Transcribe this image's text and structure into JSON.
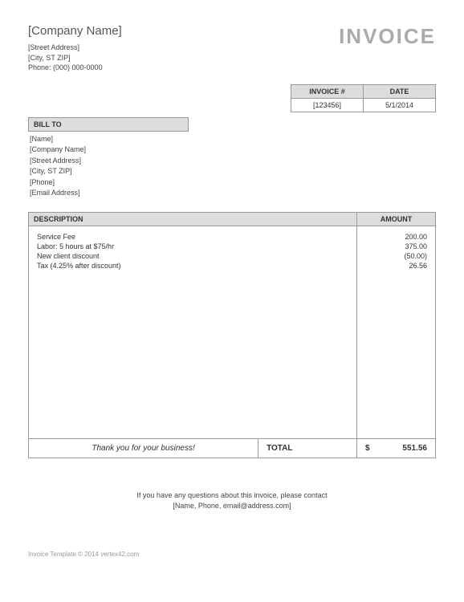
{
  "company": {
    "name": "[Company Name]",
    "street": "[Street Address]",
    "cityzip": "[City, ST  ZIP]",
    "phone": "Phone: (000) 000-0000"
  },
  "title": "INVOICE",
  "meta": {
    "invoice_header": "INVOICE #",
    "date_header": "DATE",
    "invoice_number": "[123456]",
    "date": "5/1/2014"
  },
  "billto": {
    "header": "BILL TO",
    "name": "[Name]",
    "company": "[Company Name]",
    "street": "[Street Address]",
    "cityzip": "[City, ST  ZIP]",
    "phone": "[Phone]",
    "email": "[Email Address]"
  },
  "columns": {
    "description": "DESCRIPTION",
    "amount": "AMOUNT"
  },
  "items": [
    {
      "desc": "Service Fee",
      "amount": "200.00"
    },
    {
      "desc": "Labor: 5 hours at $75/hr",
      "amount": "375.00"
    },
    {
      "desc": "New client discount",
      "amount": "(50.00)"
    },
    {
      "desc": "Tax (4.25% after discount)",
      "amount": "26.56"
    }
  ],
  "thankyou": "Thank you for your business!",
  "total": {
    "label": "TOTAL",
    "currency": "$",
    "amount": "551.56"
  },
  "questions": {
    "line1": "If you have any questions about this invoice, please contact",
    "line2": "[Name, Phone, email@address.com]"
  },
  "footer": "Invoice Template © 2014 vertex42.com"
}
